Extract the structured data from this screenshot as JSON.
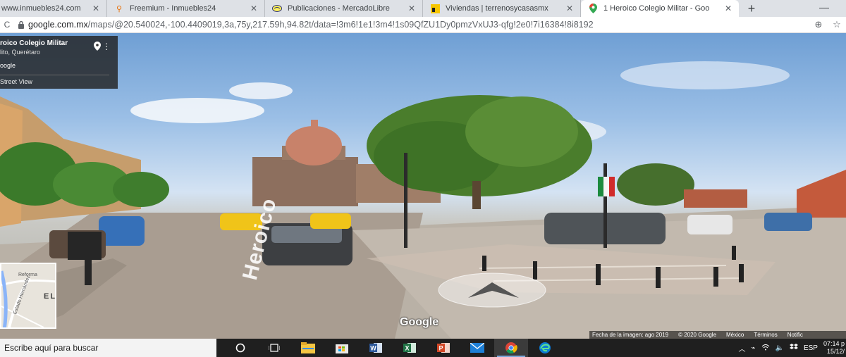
{
  "browser": {
    "tabs": [
      {
        "title": "www.inmuebles24.com",
        "favicon": "page-icon",
        "active": false
      },
      {
        "title": "Freemium - Inmuebles24",
        "favicon": "pin-icon",
        "active": false
      },
      {
        "title": "Publicaciones - MercadoLibre",
        "favicon": "handshake-icon",
        "active": false
      },
      {
        "title": "Viviendas | terrenosycasasmx",
        "favicon": "yellow-square-icon",
        "active": false
      },
      {
        "title": "1 Heroico Colegio Militar - Goo",
        "favicon": "maps-pin-icon",
        "active": true
      }
    ],
    "new_tab_symbol": "+",
    "window_control": "—",
    "url_host": "google.com.mx",
    "url_path": "/maps/@20.540024,-100.4409019,3a,75y,217.59h,94.82t/data=!3m6!1e1!3m4!1s09QfZU1Dy0pmzVxUJ3-qfg!2e0!7i16384!8i8192"
  },
  "streetview": {
    "place_title": "roico Colegio Militar",
    "place_subtitle": "lito, Querétaro",
    "provider": "oogle",
    "view_label": "Street View",
    "street_name": "Heroico",
    "minimap_label_1": "Reforma",
    "minimap_label_2": "Estado Hernández",
    "minimap_label_3": "EL",
    "watermark": "Google",
    "footer_items": [
      "Fecha de la imagen: ago 2019",
      "© 2020 Google",
      "México",
      "Términos",
      "Notific"
    ]
  },
  "taskbar": {
    "search_placeholder": "Escribe aquí para buscar",
    "apps": [
      {
        "name": "task-view-icon",
        "active": false
      },
      {
        "name": "file-explorer-icon",
        "active": false
      },
      {
        "name": "store-icon",
        "active": false
      },
      {
        "name": "word-icon",
        "active": false
      },
      {
        "name": "excel-icon",
        "active": false
      },
      {
        "name": "powerpoint-icon",
        "active": false
      },
      {
        "name": "mail-icon",
        "active": false
      },
      {
        "name": "chrome-icon",
        "active": true
      },
      {
        "name": "edge-icon",
        "active": false
      }
    ],
    "language": "ESP",
    "time": "07:14 p",
    "date": "15/12/"
  },
  "colors": {
    "taskbar_bg": "#1f1f1f",
    "tabstrip_bg": "#dee1e6",
    "accent": "#7aa7d9"
  }
}
